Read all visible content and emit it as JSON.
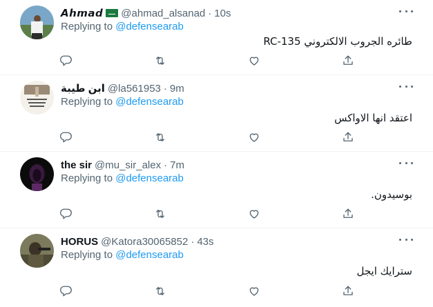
{
  "tweets": [
    {
      "name": "𝘼𝙝𝙢𝙖𝙙",
      "has_flag": true,
      "handle": "@ahmad_alsanad",
      "time": "10s",
      "replying_prefix": "Replying to",
      "replying_to": "@defensearab",
      "text": "طائره الجروب الالكتروني RC-135"
    },
    {
      "name": "ابن طيبة",
      "has_flag": false,
      "handle": "@la561953",
      "time": "9m",
      "replying_prefix": "Replying to",
      "replying_to": "@defensearab",
      "text": "اعتقد انها الاواكس"
    },
    {
      "name": "the sir",
      "has_flag": false,
      "handle": "@mu_sir_alex",
      "time": "7m",
      "replying_prefix": "Replying to",
      "replying_to": "@defensearab",
      "text": "بوسيدون."
    },
    {
      "name": "HORUS",
      "has_flag": false,
      "handle": "@Katora30065852",
      "time": "43s",
      "replying_prefix": "Replying to",
      "replying_to": "@defensearab",
      "text": "سترايك ايجل"
    }
  ],
  "separator": "·",
  "colors": {
    "link": "#1d9bf0",
    "secondary": "#536471",
    "text": "#0f1419",
    "divider": "#eff3f4"
  },
  "icons": [
    "reply-icon",
    "retweet-icon",
    "like-icon",
    "share-icon",
    "more-icon",
    "saudi-flag-icon"
  ]
}
